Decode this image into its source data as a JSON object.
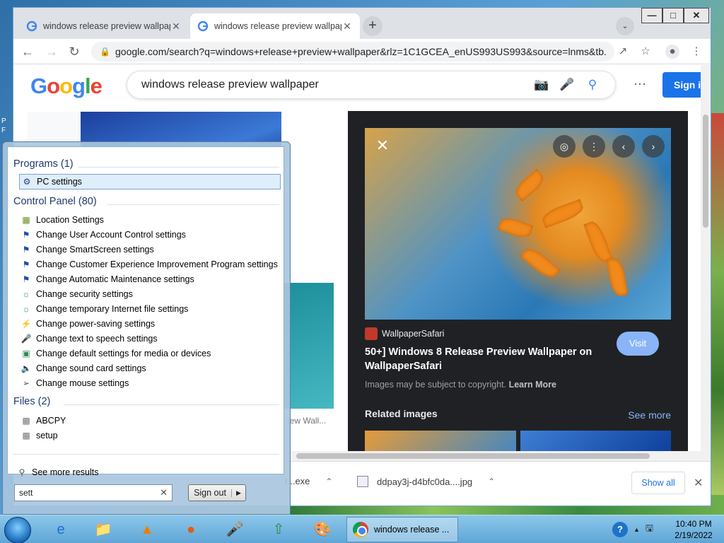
{
  "desktop": {
    "icon_text": "P\nF"
  },
  "window_controls": {
    "minimize": "—",
    "maximize": "□",
    "close": "✕"
  },
  "chrome": {
    "tabs": [
      {
        "title": "windows release preview wallpap",
        "close": "✕"
      },
      {
        "title": "windows release preview wallpap",
        "close": "✕"
      }
    ],
    "new_tab": "+",
    "tab_search": "⌄",
    "url": "google.com/search?q=windows+release+preview+wallpaper&rlz=1C1GCEA_enUS993US993&source=lnms&tb..."
  },
  "google": {
    "logo": [
      "G",
      "o",
      "o",
      "g",
      "l",
      "e"
    ],
    "logo_colors": [
      "#4285f4",
      "#ea4335",
      "#fbbc05",
      "#4285f4",
      "#34a853",
      "#ea4335"
    ],
    "query": "windows release preview wallpaper",
    "signin": "Sign i",
    "thumb_caption": "iew Wall..."
  },
  "preview": {
    "source": "WallpaperSafari",
    "visit": "Visit",
    "title": "50+] Windows 8 Release Preview Wallpaper on WallpaperSafari",
    "copyright": "Images may be subject to copyright.",
    "learn_more": "Learn More",
    "related": "Related images",
    "see_more": "See more"
  },
  "downloads": {
    "item1": "t...exe",
    "item2": "ddpay3j-d4bfc0da....jpg",
    "show_all": "Show all"
  },
  "start_menu": {
    "programs_header": "Programs (1)",
    "programs": [
      {
        "label": "PC settings",
        "icon": "gear-icon"
      }
    ],
    "control_panel_header": "Control Panel (80)",
    "control_panel": [
      {
        "label": "Location Settings",
        "icon": "location-icon"
      },
      {
        "label": "Change User Account Control settings",
        "icon": "flag-icon"
      },
      {
        "label": "Change SmartScreen settings",
        "icon": "flag-icon"
      },
      {
        "label": "Change Customer Experience Improvement Program settings",
        "icon": "flag-icon"
      },
      {
        "label": "Change Automatic Maintenance settings",
        "icon": "flag-icon"
      },
      {
        "label": "Change security settings",
        "icon": "globe-icon"
      },
      {
        "label": "Change temporary Internet file settings",
        "icon": "globe-icon"
      },
      {
        "label": "Change power-saving settings",
        "icon": "power-icon"
      },
      {
        "label": "Change text to speech settings",
        "icon": "microphone-icon"
      },
      {
        "label": "Change default settings for media or devices",
        "icon": "media-icon"
      },
      {
        "label": "Change sound card settings",
        "icon": "speaker-icon"
      },
      {
        "label": "Change mouse settings",
        "icon": "mouse-icon"
      }
    ],
    "files_header": "Files (2)",
    "files": [
      {
        "label": "ABCPY",
        "icon": "file-icon"
      },
      {
        "label": "setup",
        "icon": "file-icon"
      }
    ],
    "see_more": "See more results",
    "search_value": "sett",
    "sign_out": "Sign out"
  },
  "taskbar": {
    "task_title": "windows release ...",
    "time": "10:40 PM",
    "date": "2/19/2022",
    "help": "?"
  }
}
